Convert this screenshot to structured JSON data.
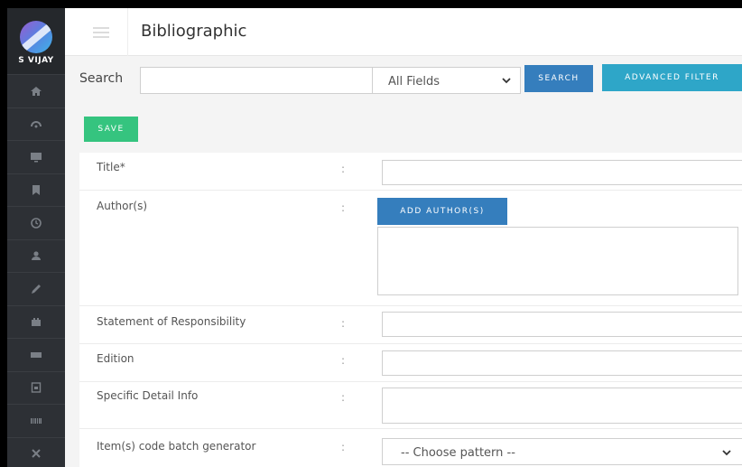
{
  "sidebar": {
    "brand_name": "S VIJAY",
    "items": [
      {
        "icon": "home-icon"
      },
      {
        "icon": "dashboard-icon"
      },
      {
        "icon": "monitor-icon"
      },
      {
        "icon": "bookmark-icon"
      },
      {
        "icon": "clock-icon"
      },
      {
        "icon": "user-icon"
      },
      {
        "icon": "pencil-icon"
      },
      {
        "icon": "building-icon"
      },
      {
        "icon": "keyboard-icon"
      },
      {
        "icon": "document-icon"
      },
      {
        "icon": "barcode-icon"
      },
      {
        "icon": "tools-icon"
      }
    ]
  },
  "header": {
    "title": "Bibliographic"
  },
  "search": {
    "label": "Search",
    "value": "",
    "field_select": "All Fields",
    "search_button": "SEARCH",
    "advanced_button": "ADVANCED FILTER"
  },
  "form": {
    "save_button": "SAVE",
    "colon": ":",
    "title_label": "Title*",
    "authors_label": "Author(s)",
    "add_author_button": "ADD AUTHOR(S)",
    "statement_label": "Statement of Responsibility",
    "edition_label": "Edition",
    "specific_label": "Specific Detail Info",
    "batch_label": "Item(s) code batch generator",
    "batch_select": "-- Choose pattern --"
  },
  "colors": {
    "sidebar_bg": "#2d3035",
    "save_green": "#35c47f",
    "primary_blue": "#357ebd",
    "info_teal": "#2ea6c8"
  }
}
